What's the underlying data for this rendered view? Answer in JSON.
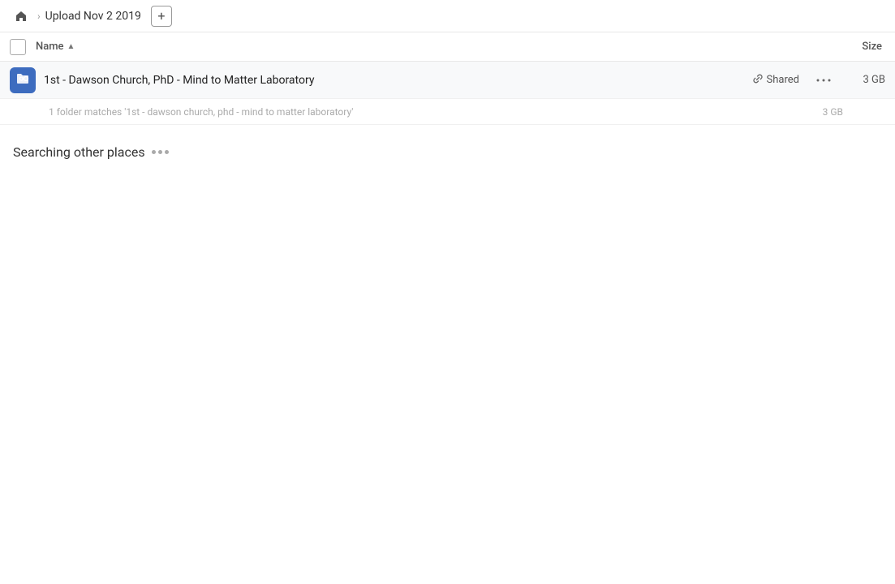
{
  "breadcrumb": {
    "home_label": "Home",
    "title": "Upload Nov 2 2019",
    "add_button_label": "+"
  },
  "columns": {
    "name_label": "Name",
    "sort_indicator": "▲",
    "size_label": "Size"
  },
  "file_row": {
    "icon_label": "folder-link-icon",
    "name": "1st - Dawson Church, PhD - Mind to Matter Laboratory",
    "shared_label": "Shared",
    "more_label": "•••",
    "size": "3 GB"
  },
  "match_info": {
    "text": "1 folder matches '1st - dawson church, phd - mind to matter laboratory'",
    "size": "3 GB"
  },
  "searching": {
    "label": "Searching other places"
  }
}
